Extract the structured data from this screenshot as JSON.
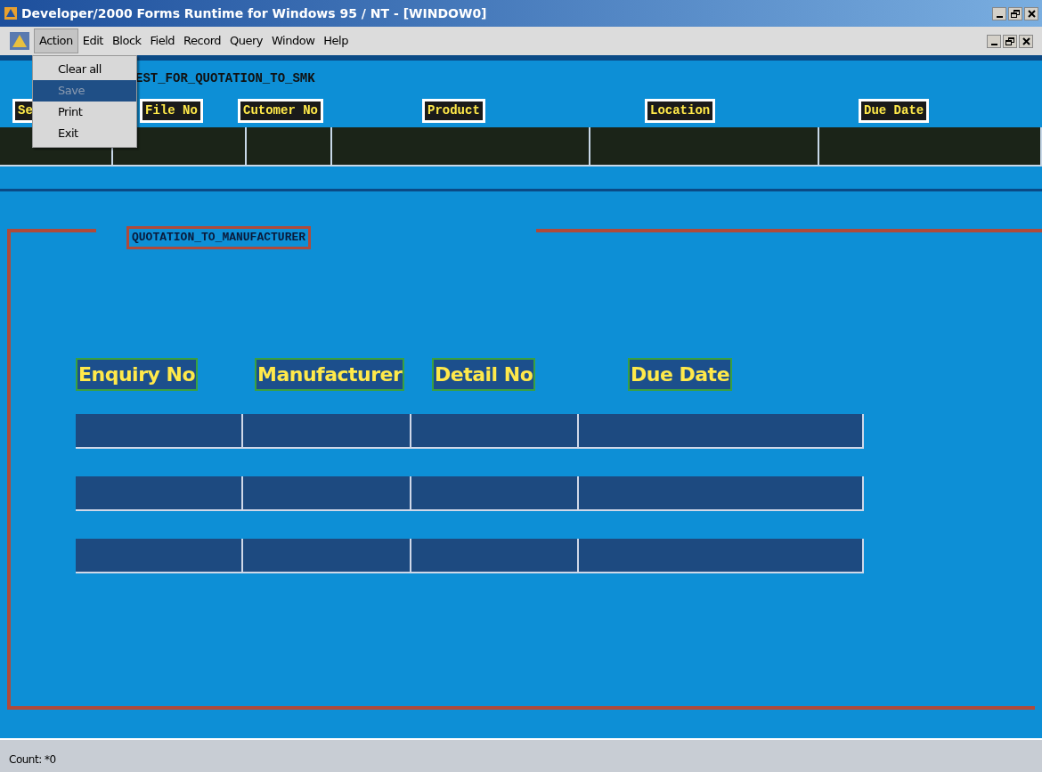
{
  "window": {
    "title": "Developer/2000 Forms Runtime for Windows 95 / NT - [WINDOW0]"
  },
  "menu": [
    {
      "label": "Action",
      "selected": true
    },
    {
      "label": "Edit",
      "selected": false
    },
    {
      "label": "Block",
      "selected": false
    },
    {
      "label": "Field",
      "selected": false
    },
    {
      "label": "Record",
      "selected": false
    },
    {
      "label": "Query",
      "selected": false
    },
    {
      "label": "Window",
      "selected": false
    },
    {
      "label": "Help",
      "selected": false
    }
  ],
  "action_menu": [
    {
      "label": "Clear all",
      "selected": false,
      "disabled": false
    },
    {
      "label": "Save",
      "selected": true,
      "disabled": true
    },
    {
      "label": "Print",
      "selected": false,
      "disabled": false
    },
    {
      "label": "Exit",
      "selected": false,
      "disabled": false
    }
  ],
  "upper_block": {
    "title": "EST_FOR_QUOTATION_TO_SMK",
    "labels": [
      "Se",
      "File No",
      "Cutomer No",
      "Product",
      "Location",
      "Due Date"
    ],
    "fields": [
      {
        "kind": "field"
      },
      {
        "kind": "field"
      },
      {
        "kind": "field"
      },
      {
        "kind": "field"
      },
      {
        "kind": "field"
      },
      {
        "kind": "field"
      }
    ]
  },
  "lower_block": {
    "title": "QUOTATION_TO_MANUFACTURER",
    "columns": [
      "Enquiry No",
      "Manufacturer",
      "Detail No",
      "Due Date"
    ],
    "rows": [
      {
        "kind": "record"
      },
      {
        "kind": "record"
      },
      {
        "kind": "record"
      }
    ]
  },
  "status_bar": {
    "text": "Count: *0"
  }
}
